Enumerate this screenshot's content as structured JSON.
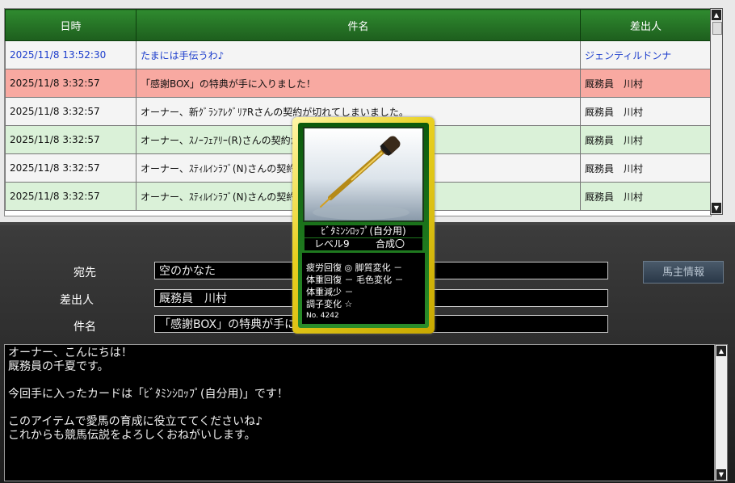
{
  "mail_list": {
    "columns": [
      "日時",
      "件名",
      "差出人"
    ],
    "rows": [
      {
        "datetime": "2025/11/8 13:52:30",
        "subject": "たまには手伝うわ♪",
        "sender": "ジェンティルドンナ",
        "style": "row-white row-blue"
      },
      {
        "datetime": "2025/11/8 3:32:57",
        "subject": "「感謝BOX」の特典が手に入りました！",
        "sender": "厩務員　川村",
        "style": "row-pink"
      },
      {
        "datetime": "2025/11/8 3:32:57",
        "subject": "オーナー、新ｸﾞﾗﾝｱﾚｸﾞﾘｱRさんの契約が切れてしまいました。",
        "sender": "厩務員　川村",
        "style": "row-white"
      },
      {
        "datetime": "2025/11/8 3:32:57",
        "subject": "オーナー、ｽﾉｰﾌｪｱﾘｰ(R)さんの契約が切れてしまいました。",
        "sender": "厩務員　川村",
        "style": "row-green"
      },
      {
        "datetime": "2025/11/8 3:32:57",
        "subject": "オーナー、ｽﾃｨﾙｲﾝﾗﾌﾞ(N)さんの契約が切れてしまいました。",
        "sender": "厩務員　川村",
        "style": "row-white"
      },
      {
        "datetime": "2025/11/8 3:32:57",
        "subject": "オーナー、ｽﾃｨﾙｲﾝﾗﾌﾞ(N)さんの契約が切れてしまいました。",
        "sender": "厩務員　川村",
        "style": "row-green"
      }
    ]
  },
  "detail": {
    "to_label": "宛先",
    "to_value": "空のかなた",
    "from_label": "差出人",
    "from_value": "厩務員　川村",
    "subject_label": "件名",
    "subject_value": "「感謝BOX」の特典が手に入りました！",
    "horse_info_button": "馬主情報"
  },
  "message": {
    "lines": [
      "オーナー、こんにちは！",
      "厩務員の千夏です。",
      "",
      "今回手に入ったカードは「ﾋﾞﾀﾐﾝｼﾛｯﾌﾟ(自分用)」です！",
      "",
      "このアイテムで愛馬の育成に役立ててくださいね♪",
      "これからも競馬伝説をよろしくおねがいします。"
    ]
  },
  "card": {
    "name": "ﾋﾞﾀﾐﾝｼﾛｯﾌﾟ(自分用)",
    "level": "レベル9",
    "synthesis": "合成〇",
    "stats": [
      "疲労回復 ◎ 脚質変化 －",
      "体重回復 － 毛色変化 －",
      "体重減少 －",
      "調子変化 ☆"
    ],
    "number": "No. 4242",
    "image_icon": "dropper-icon"
  },
  "icons": {
    "scroll_up": "scroll-up-arrow-icon",
    "scroll_down": "scroll-down-arrow-icon"
  },
  "colors": {
    "header_green": "#1d6a1d",
    "highlight_pink": "#f8a9a1",
    "row_green": "#daf1d8",
    "link_blue": "#1b3ccc",
    "card_gold": "#e8d020"
  }
}
